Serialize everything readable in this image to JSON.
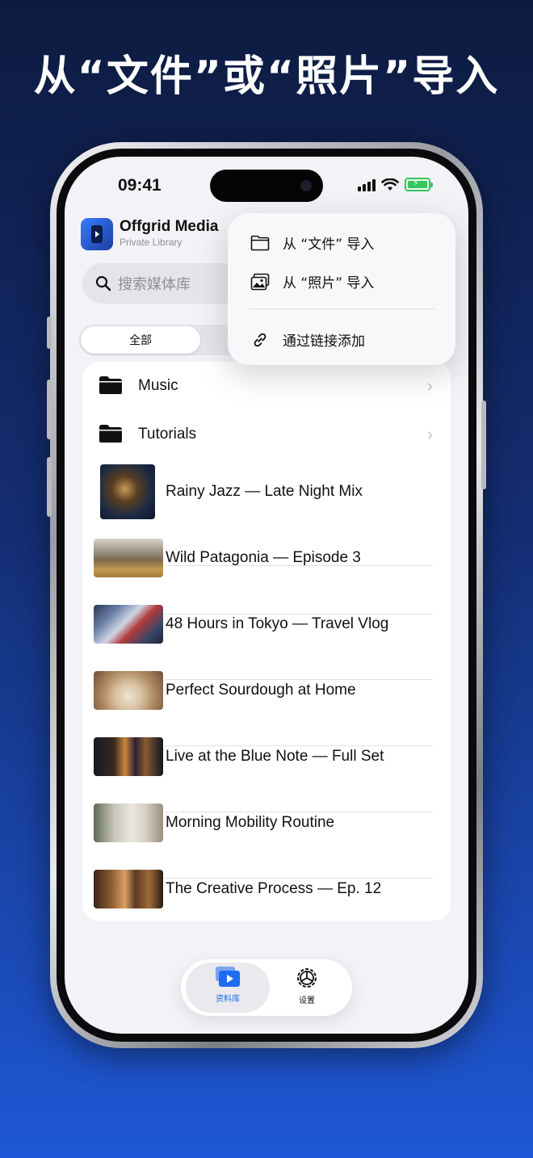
{
  "headline": "从“文件”或“照片”导入",
  "status_bar": {
    "time": "09:41"
  },
  "header": {
    "app_name": "Offgrid Media",
    "subtitle": "Private Library"
  },
  "search": {
    "placeholder": "搜索媒体库"
  },
  "segment": {
    "active_label": "全部"
  },
  "list": {
    "folders": [
      {
        "name": "Music"
      },
      {
        "name": "Tutorials"
      }
    ],
    "videos": [
      {
        "title": "Rainy Jazz — Late Night Mix"
      },
      {
        "title": "Wild Patagonia — Episode 3"
      },
      {
        "title": "48 Hours in Tokyo — Travel Vlog"
      },
      {
        "title": "Perfect Sourdough at Home"
      },
      {
        "title": "Live at the Blue Note — Full Set"
      },
      {
        "title": "Morning Mobility Routine"
      },
      {
        "title": "The Creative Process — Ep. 12"
      }
    ]
  },
  "import_menu": {
    "from_files": "从 “文件” 导入",
    "from_photos": "从 “照片” 导入",
    "via_link": "通过链接添加"
  },
  "tab_bar": {
    "library": "资料库",
    "settings": "设置"
  },
  "colors": {
    "accent": "#1f6cf0",
    "background_top": "#0d1b3f",
    "background_bottom": "#1e58d6"
  }
}
